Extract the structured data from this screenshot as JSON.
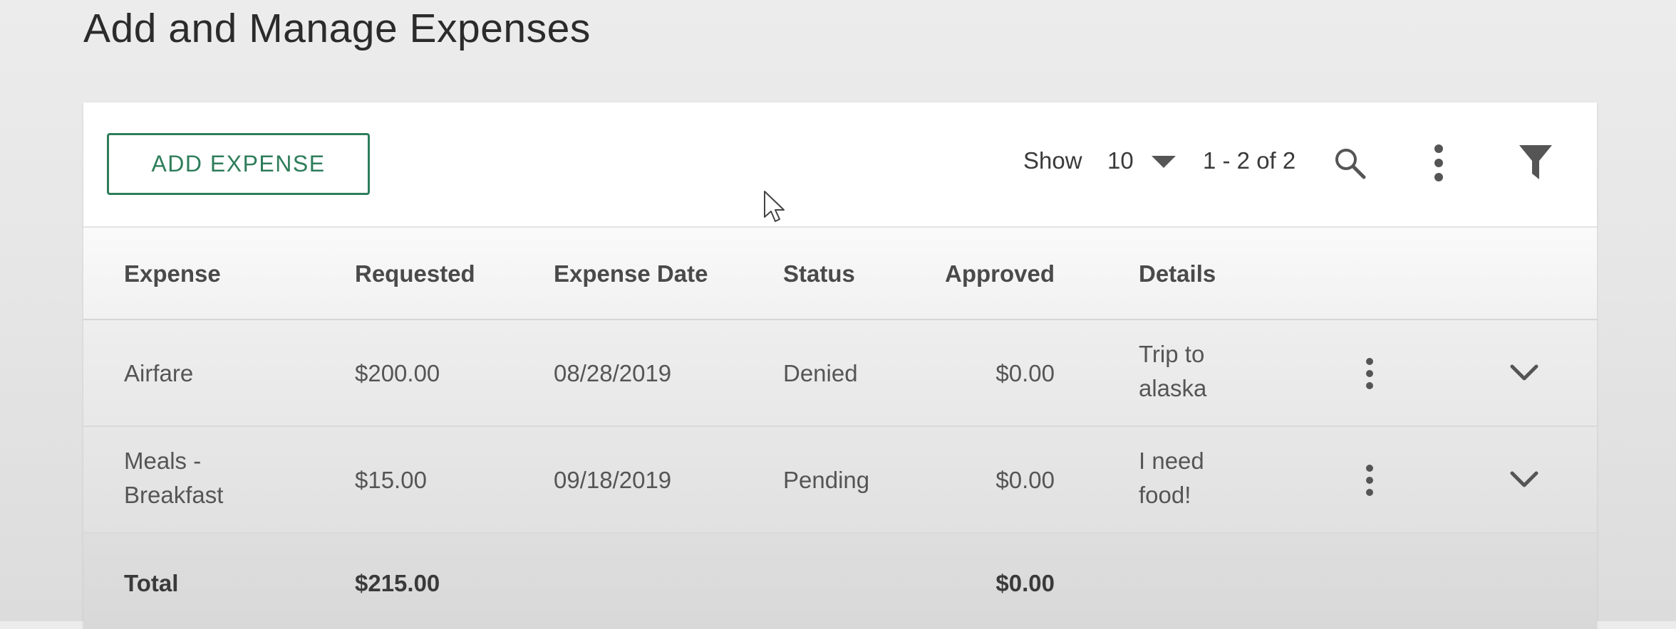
{
  "page": {
    "title": "Add and Manage Expenses"
  },
  "toolbar": {
    "add_label": "ADD EXPENSE",
    "show_label": "Show",
    "page_size": "10",
    "page_range": "1 - 2 of 2",
    "icons": [
      "search-icon",
      "more-vertical-icon",
      "filter-icon"
    ]
  },
  "table": {
    "headers": {
      "expense": "Expense",
      "requested": "Requested",
      "date": "Expense Date",
      "status": "Status",
      "approved": "Approved",
      "details": "Details"
    },
    "rows": [
      {
        "expense": "Airfare",
        "requested": "$200.00",
        "date": "08/28/2019",
        "status": "Denied",
        "approved": "$0.00",
        "details": "Trip to alaska"
      },
      {
        "expense": "Meals - Breakfast",
        "requested": "$15.00",
        "date": "09/18/2019",
        "status": "Pending",
        "approved": "$0.00",
        "details": "I need food!"
      }
    ],
    "total": {
      "label": "Total",
      "requested": "$215.00",
      "approved": "$0.00"
    }
  },
  "colors": {
    "accent": "#2e7d5a",
    "text": "#444444",
    "background": "#e6e6e6"
  }
}
